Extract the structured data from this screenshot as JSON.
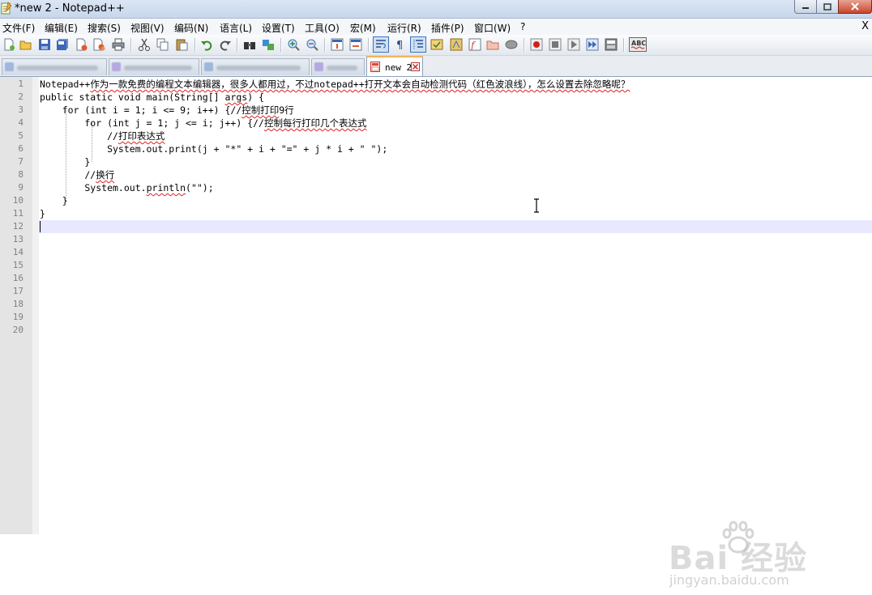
{
  "window": {
    "title": "*new 2 - Notepad++"
  },
  "menu": {
    "items": [
      "文件(F)",
      "编辑(E)",
      "搜索(S)",
      "视图(V)",
      "编码(N)",
      "语言(L)",
      "设置(T)",
      "工具(O)",
      "宏(M)",
      "运行(R)",
      "插件(P)",
      "窗口(W)",
      "?"
    ],
    "close": "X"
  },
  "toolbar": {
    "icons": [
      "new-file-icon",
      "open-file-icon",
      "save-icon",
      "save-all-icon",
      "close-icon",
      "close-all-icon",
      "print-icon",
      "cut-icon",
      "copy-icon",
      "paste-icon",
      "undo-icon",
      "redo-icon",
      "find-icon",
      "replace-icon",
      "zoom-in-icon",
      "zoom-out-icon",
      "sync-vertical-icon",
      "sync-horizontal-icon",
      "word-wrap-icon",
      "show-all-chars-icon",
      "indent-guide-icon",
      "udl-icon",
      "doc-map-icon",
      "function-list-icon",
      "folder-workspace-icon",
      "monitor-icon",
      "macro-record-icon",
      "macro-stop-icon",
      "macro-play-icon",
      "macro-run-multiple-icon",
      "macro-save-icon",
      "spell-check-icon"
    ],
    "spell_check_label": "ABC"
  },
  "tabs": {
    "active_label": "new 2"
  },
  "editor": {
    "line_numbers": [
      "1",
      "2",
      "3",
      "4",
      "5",
      "6",
      "7",
      "8",
      "9",
      "10",
      "11",
      "12",
      "13",
      "14",
      "15",
      "16",
      "17",
      "18",
      "19",
      "20"
    ],
    "lines": [
      {
        "plain": "Notepad++",
        "squiggle": "作为一款免费的编程文本编辑器，很多人都用过，不过notepad++打开文本会自动检测代码（红色波浪线），怎么设置去除忽略呢？"
      },
      {
        "pre": "public static void main(String[] ",
        "sq": "args",
        "post": ") {"
      },
      {
        "pre": "    for (int i = 1; i <= 9; i++) {//",
        "sq": "控制打印",
        "post": "9行"
      },
      {
        "pre": "        for (int j = 1; j <= i; j++) {//",
        "sq": "控制每行打印几个表达式",
        "post": ""
      },
      {
        "pre": "            //",
        "sq": "打印表达式",
        "post": ""
      },
      {
        "pre": "            System.out.print(j + \"*\" + i + \"=\" + j * i + \" \");",
        "sq": "",
        "post": ""
      },
      {
        "pre": "        }",
        "sq": "",
        "post": ""
      },
      {
        "pre": "        //",
        "sq": "换行",
        "post": ""
      },
      {
        "pre": "        System.out.",
        "sq": "println",
        "post": "(\"\");"
      },
      {
        "pre": "    }",
        "sq": "",
        "post": ""
      },
      {
        "pre": "}",
        "sq": "",
        "post": ""
      }
    ]
  },
  "watermark": {
    "brand": "Bai  经验",
    "url": "jingyan.baidu.com"
  }
}
